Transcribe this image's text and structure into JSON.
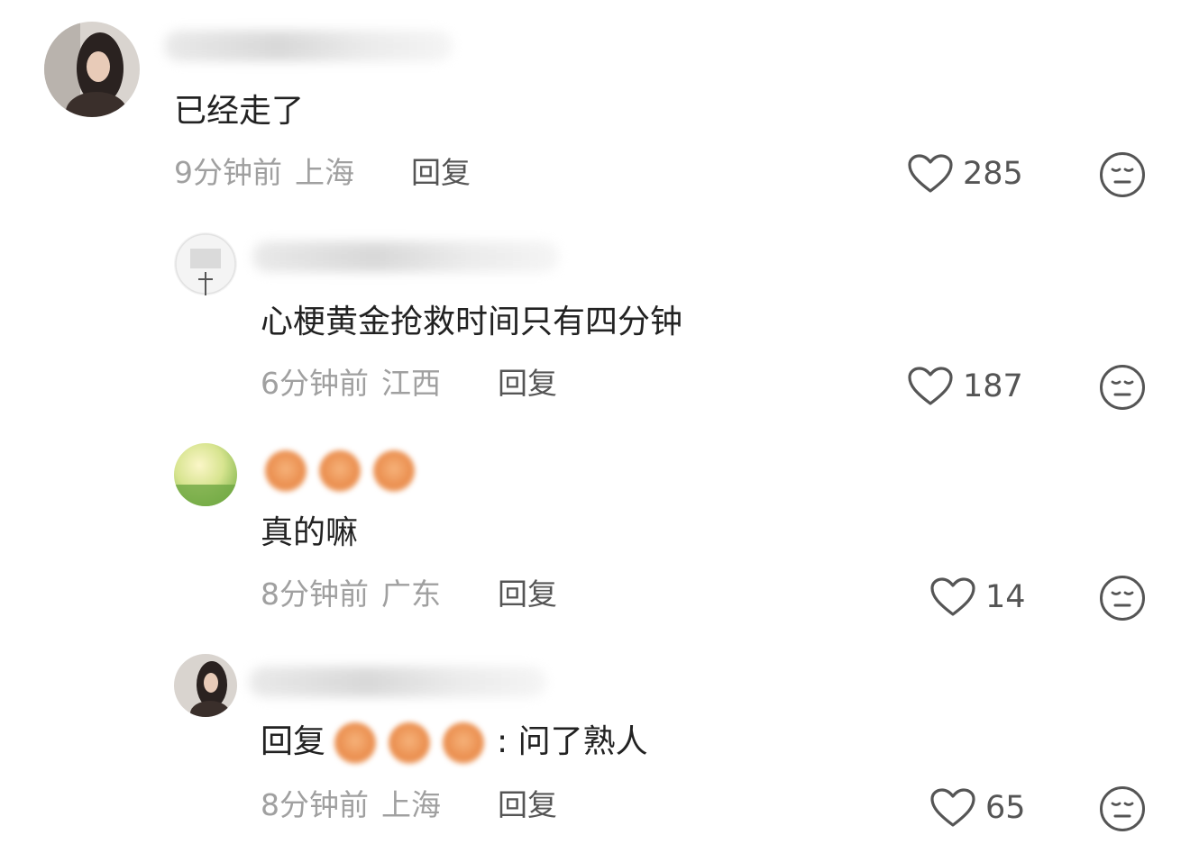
{
  "comments": [
    {
      "text": "已经走了",
      "time": "9分钟前",
      "location": "上海",
      "reply_label": "回复",
      "likes": "285"
    },
    {
      "text": "心梗黄金抢救时间只有四分钟",
      "time": "6分钟前",
      "location": "江西",
      "reply_label": "回复",
      "likes": "187"
    },
    {
      "text": "真的嘛",
      "time": "8分钟前",
      "location": "广东",
      "reply_label": "回复",
      "likes": "14"
    },
    {
      "reply_prefix": "回复",
      "text": ": 问了熟人",
      "time": "8分钟前",
      "location": "上海",
      "reply_label": "回复",
      "likes": "65"
    }
  ],
  "icons": {
    "like": "heart-outline-icon",
    "react": "neutral-face-icon"
  },
  "colors": {
    "text": "#222222",
    "meta": "#a0a0a0",
    "action": "#555555"
  }
}
